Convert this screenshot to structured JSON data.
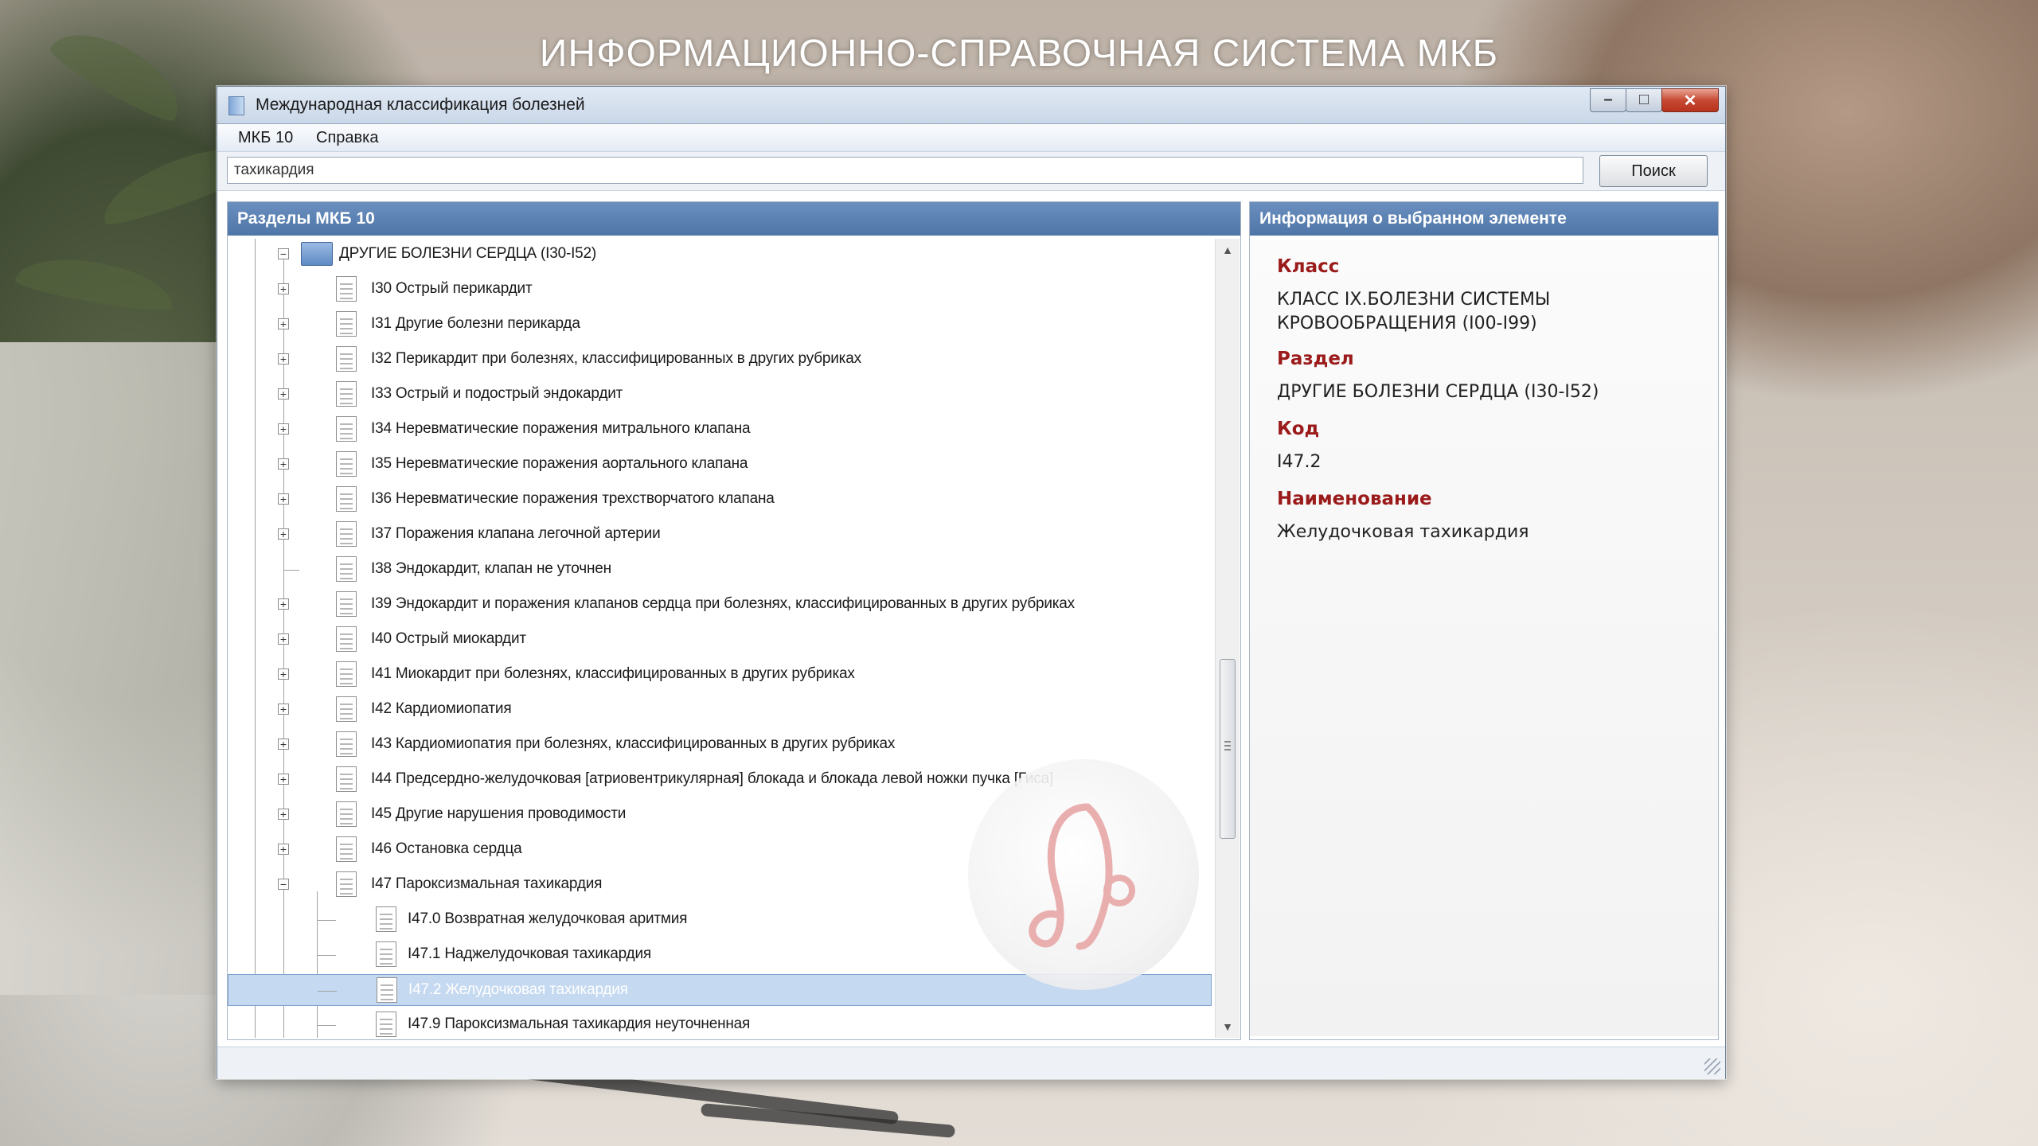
{
  "page_title": "ИНФОРМАЦИОННО-СПРАВОЧНАЯ СИСТЕМА МКБ",
  "window": {
    "title": "Международная классификация болезней",
    "controls": [
      "minimize",
      "maximize",
      "close"
    ]
  },
  "menu": [
    {
      "label": "МКБ 10"
    },
    {
      "label": "Справка"
    }
  ],
  "search": {
    "value": "тахикардия",
    "button_label": "Поиск"
  },
  "tree_panel": {
    "header": "Разделы МКБ 10",
    "root": {
      "label": "ДРУГИЕ БОЛЕЗНИ СЕРДЦА (I30-I52)",
      "expanded": true
    },
    "items": [
      {
        "label": "I30 Острый перикардит",
        "expandable": true
      },
      {
        "label": "I31 Другие болезни перикарда",
        "expandable": true
      },
      {
        "label": "I32 Перикардит при болезнях, классифицированных в других рубриках",
        "expandable": true
      },
      {
        "label": "I33 Острый и подострый эндокардит",
        "expandable": true
      },
      {
        "label": "I34 Неревматические поражения митрального клапана",
        "expandable": true
      },
      {
        "label": "I35 Неревматические поражения аортального клапана",
        "expandable": true
      },
      {
        "label": "I36 Неревматические поражения трехстворчатого клапана",
        "expandable": true
      },
      {
        "label": "I37 Поражения клапана легочной артерии",
        "expandable": true
      },
      {
        "label": "I38 Эндокардит, клапан не уточнен",
        "expandable": false
      },
      {
        "label": "I39 Эндокардит и поражения клапанов сердца при болезнях,  классифицированных в других рубриках",
        "expandable": true
      },
      {
        "label": "I40 Острый миокардит",
        "expandable": true
      },
      {
        "label": "I41 Миокардит при болезнях, классифицированных в других рубриках",
        "expandable": true
      },
      {
        "label": "I42 Кардиомиопатия",
        "expandable": true
      },
      {
        "label": "I43 Кардиомиопатия при болезнях, классифицированных в других рубриках",
        "expandable": true
      },
      {
        "label": "I44 Предсердно-желудочковая  [атриовентрикулярная] блокада и блокада левой ножки пучка [Гиса]",
        "expandable": true
      },
      {
        "label": "I45 Другие нарушения проводимости",
        "expandable": true
      },
      {
        "label": "I46 Остановка сердца",
        "expandable": true
      },
      {
        "label": "I47 Пароксизмальная тахикардия",
        "expandable": true,
        "expanded": true
      }
    ],
    "children": [
      {
        "label": "I47.0 Возвратная желудочковая аритмия",
        "selected": false
      },
      {
        "label": "I47.1 Наджелудочковая тахикардия",
        "selected": false
      },
      {
        "label": "I47.2 Желудочковая тахикардия",
        "selected": true
      },
      {
        "label": "I47.9 Пароксизмальная тахикардия неуточненная",
        "selected": false
      }
    ]
  },
  "info_panel": {
    "header": "Информация о выбранном элементе",
    "fields": [
      {
        "label": "Класс",
        "value": "КЛАСС IX.БОЛЕЗНИ СИСТЕМЫ КРОВООБРАЩЕНИЯ (I00-I99)"
      },
      {
        "label": "Раздел",
        "value": "ДРУГИЕ БОЛЕЗНИ СЕРДЦА (I30-I52)"
      },
      {
        "label": "Код",
        "value": "I47.2"
      },
      {
        "label": "Наименование",
        "value": "Желудочковая тахикардия"
      }
    ]
  },
  "colors": {
    "panel_header": "#5a80b2",
    "selection": "#c5d9f1",
    "info_label": "#9b1b1b"
  }
}
